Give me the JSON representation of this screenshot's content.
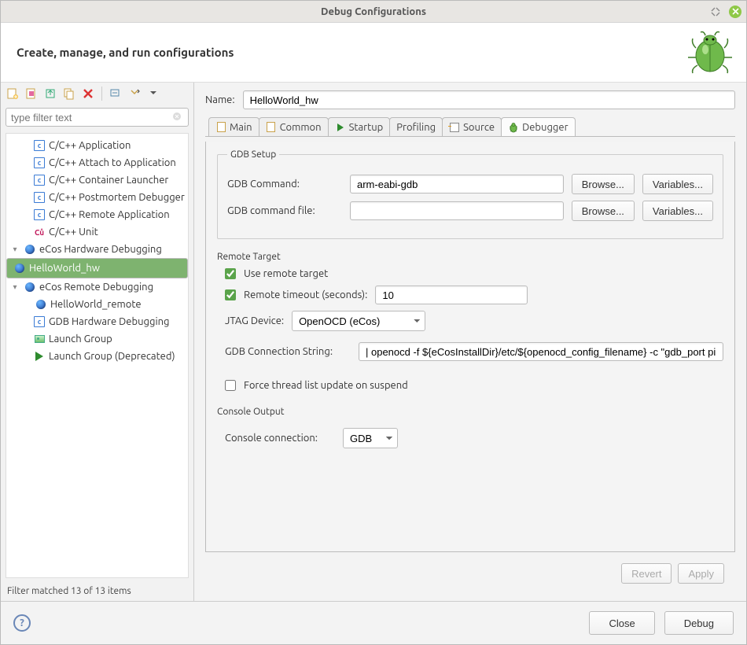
{
  "window": {
    "title": "Debug Configurations"
  },
  "banner": {
    "heading": "Create, manage, and run configurations"
  },
  "filter": {
    "placeholder": "type filter text"
  },
  "filter_status": "Filter matched 13 of 13 items",
  "tree": {
    "n0": "C/C++ Application",
    "n1": "C/C++ Attach to Application",
    "n2": "C/C++ Container Launcher",
    "n3": "C/C++ Postmortem Debugger",
    "n4": "C/C++ Remote Application",
    "n5": "C/C++ Unit",
    "n6": "eCos Hardware Debugging",
    "n6c0": "HelloWorld_hw",
    "n7": "eCos Remote Debugging",
    "n7c0": "HelloWorld_remote",
    "n8": "GDB Hardware Debugging",
    "n9": "Launch Group",
    "n10": "Launch Group (Deprecated)"
  },
  "labels": {
    "name": "Name:"
  },
  "name_value": "HelloWorld_hw",
  "tabs": {
    "main": "Main",
    "common": "Common",
    "startup": "Startup",
    "profiling": "Profiling",
    "source": "Source",
    "debugger": "Debugger"
  },
  "gdb": {
    "legend": "GDB Setup",
    "cmd_label": "GDB Command:",
    "cmd_value": "arm-eabi-gdb",
    "file_label": "GDB command file:",
    "file_value": "",
    "browse": "Browse...",
    "variables": "Variables..."
  },
  "remote": {
    "title": "Remote Target",
    "use_label": "Use remote target",
    "timeout_label": "Remote timeout (seconds):",
    "timeout_value": "10",
    "jtag_label": "JTAG Device:",
    "jtag_value": "OpenOCD (eCos)",
    "conn_label": "GDB Connection String:",
    "conn_value": "| openocd -f ${eCosInstallDir}/etc/${openocd_config_filename} -c \"gdb_port pipe\"",
    "force_label": "Force thread list update on suspend"
  },
  "console": {
    "title": "Console Output",
    "conn_label": "Console connection:",
    "conn_value": "GDB"
  },
  "buttons": {
    "revert": "Revert",
    "apply": "Apply",
    "close": "Close",
    "debug": "Debug"
  }
}
